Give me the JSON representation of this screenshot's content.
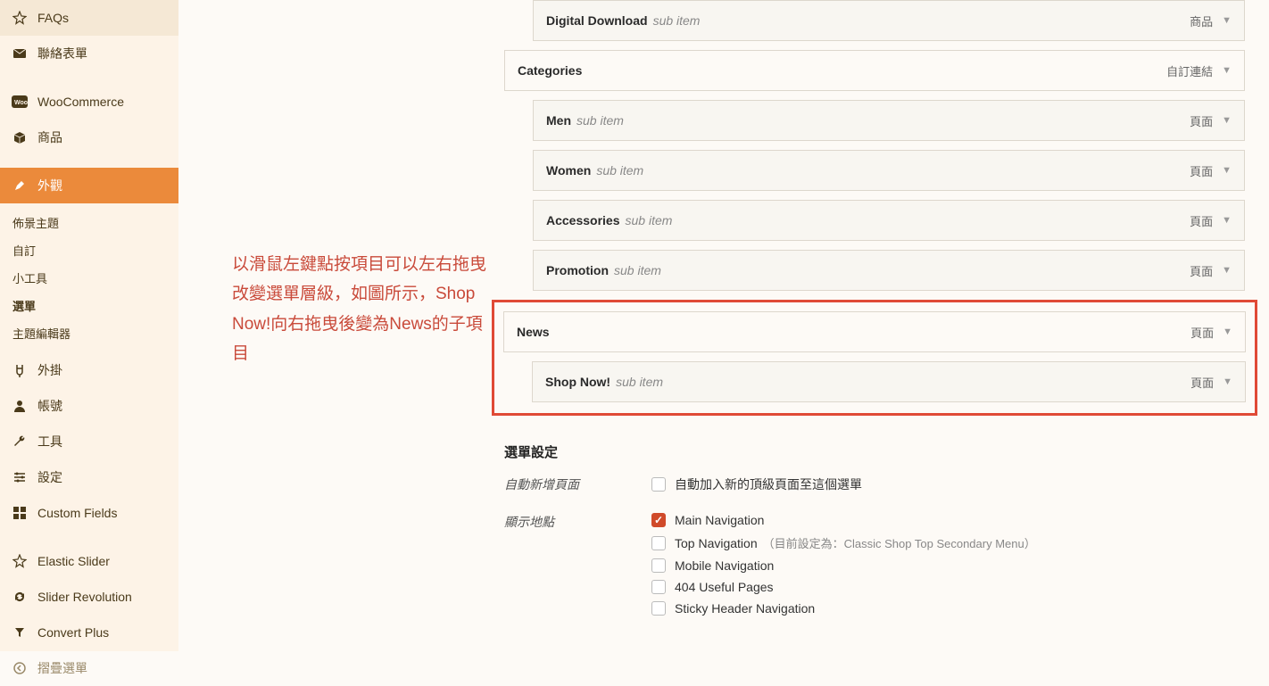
{
  "sidebar": {
    "items": [
      {
        "label": "FAQs",
        "icon": "pin"
      },
      {
        "label": "聯絡表單",
        "icon": "mail"
      },
      {
        "label": "WooCommerce",
        "icon": "woo"
      },
      {
        "label": "商品",
        "icon": "box"
      },
      {
        "label": "外觀",
        "icon": "brush",
        "active": true
      },
      {
        "label": "外掛",
        "icon": "plug"
      },
      {
        "label": "帳號",
        "icon": "user"
      },
      {
        "label": "工具",
        "icon": "wrench"
      },
      {
        "label": "設定",
        "icon": "sliders"
      },
      {
        "label": "Custom Fields",
        "icon": "grid"
      },
      {
        "label": "Elastic Slider",
        "icon": "pin"
      },
      {
        "label": "Slider Revolution",
        "icon": "refresh"
      },
      {
        "label": "Convert Plus",
        "icon": "convert"
      }
    ],
    "submenu": [
      {
        "label": "佈景主題"
      },
      {
        "label": "自訂"
      },
      {
        "label": "小工具"
      },
      {
        "label": "選單",
        "bold": true
      },
      {
        "label": "主題編輯器"
      }
    ],
    "collapse": "摺疊選單"
  },
  "annotation": "以滑鼠左鍵點按項目可以左右拖曳改變選單層級，如圖所示，Shop Now!向右拖曳後變為News的子項目",
  "menuItems": [
    {
      "title": "Digital Download",
      "sub": "sub item",
      "type": "商品",
      "indent": true
    },
    {
      "title": "Categories",
      "sub": "",
      "type": "自訂連結",
      "indent": false,
      "plain": true
    },
    {
      "title": "Men",
      "sub": "sub item",
      "type": "頁面",
      "indent": true
    },
    {
      "title": "Women",
      "sub": "sub item",
      "type": "頁面",
      "indent": true
    },
    {
      "title": "Accessories",
      "sub": "sub item",
      "type": "頁面",
      "indent": true
    },
    {
      "title": "Promotion",
      "sub": "sub item",
      "type": "頁面",
      "indent": true
    }
  ],
  "highlight": [
    {
      "title": "News",
      "sub": "",
      "type": "頁面",
      "indent": false,
      "plain": true
    },
    {
      "title": "Shop Now!",
      "sub": "sub item",
      "type": "頁面",
      "indent": true
    }
  ],
  "settings": {
    "heading": "選單設定",
    "autoAddLabel": "自動新增頁面",
    "autoAddText": "自動加入新的頂級頁面至這個選單",
    "displayLabel": "顯示地點",
    "locations": [
      {
        "label": "Main Navigation",
        "checked": true
      },
      {
        "label": "Top Navigation",
        "checked": false,
        "note": "（目前設定為：Classic Shop Top Secondary Menu）"
      },
      {
        "label": "Mobile Navigation",
        "checked": false
      },
      {
        "label": "404 Useful Pages",
        "checked": false
      },
      {
        "label": "Sticky Header Navigation",
        "checked": false
      }
    ]
  }
}
